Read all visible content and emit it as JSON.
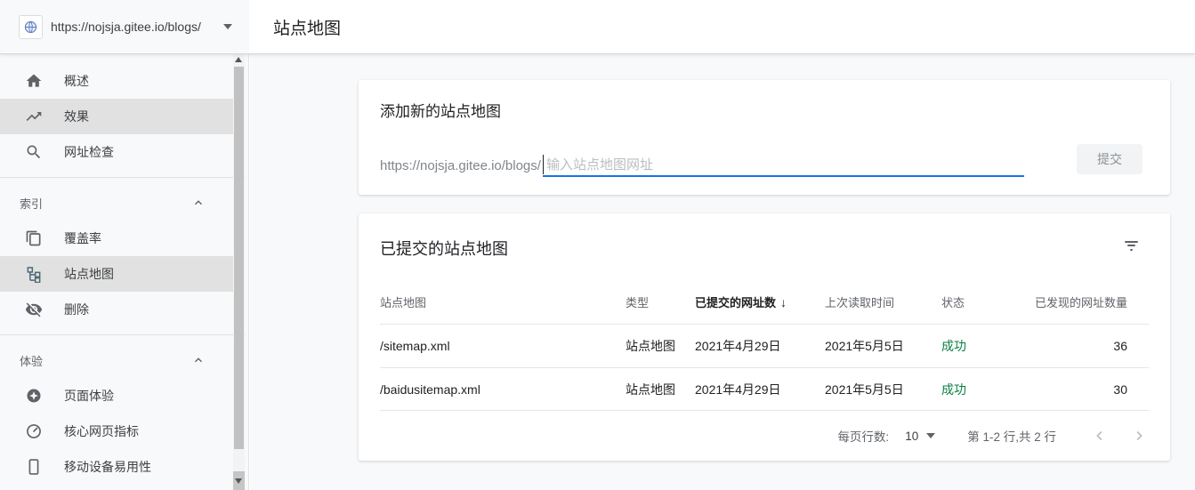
{
  "colors": {
    "accent_blue": "#1a73e8",
    "success_green": "#0b8043",
    "selected_gray": "#e1e1e1"
  },
  "property_selector": {
    "url": "https://nojsja.gitee.io/blogs/"
  },
  "page": {
    "title": "站点地图"
  },
  "sidebar": {
    "items": [
      {
        "icon": "home-icon",
        "label": "概述"
      },
      {
        "icon": "trending-up-icon",
        "label": "效果"
      },
      {
        "icon": "search-icon",
        "label": "网址检查"
      }
    ],
    "sections": [
      {
        "label": "索引",
        "items": [
          {
            "icon": "pages-icon",
            "label": "覆盖率"
          },
          {
            "icon": "sitemap-icon",
            "label": "站点地图"
          },
          {
            "icon": "eye-off-icon",
            "label": "删除"
          }
        ]
      },
      {
        "label": "体验",
        "items": [
          {
            "icon": "page-experience-icon",
            "label": "页面体验"
          },
          {
            "icon": "gauge-icon",
            "label": "核心网页指标"
          },
          {
            "icon": "smartphone-icon",
            "label": "移动设备易用性"
          }
        ]
      }
    ]
  },
  "add_card": {
    "title": "添加新的站点地图",
    "url_prefix": "https://nojsja.gitee.io/blogs/",
    "placeholder": "输入站点地图网址",
    "submit_label": "提交"
  },
  "submitted_card": {
    "title": "已提交的站点地图",
    "table": {
      "columns": [
        "站点地图",
        "类型",
        "已提交的网址数",
        "上次读取时间",
        "状态",
        "已发现的网址数量"
      ],
      "sort_column_index": 2,
      "sort_direction": "desc",
      "sort_arrow": "↓",
      "rows": [
        {
          "sitemap": "/sitemap.xml",
          "type": "站点地图",
          "submitted": "2021年4月29日",
          "last_read": "2021年5月5日",
          "status": "成功",
          "discovered": "36"
        },
        {
          "sitemap": "/baidusitemap.xml",
          "type": "站点地图",
          "submitted": "2021年4月29日",
          "last_read": "2021年5月5日",
          "status": "成功",
          "discovered": "30"
        }
      ]
    },
    "pagination": {
      "rows_per_page_label": "每页行数:",
      "rows_per_page": "10",
      "range": "第 1-2 行,共 2 行"
    }
  }
}
